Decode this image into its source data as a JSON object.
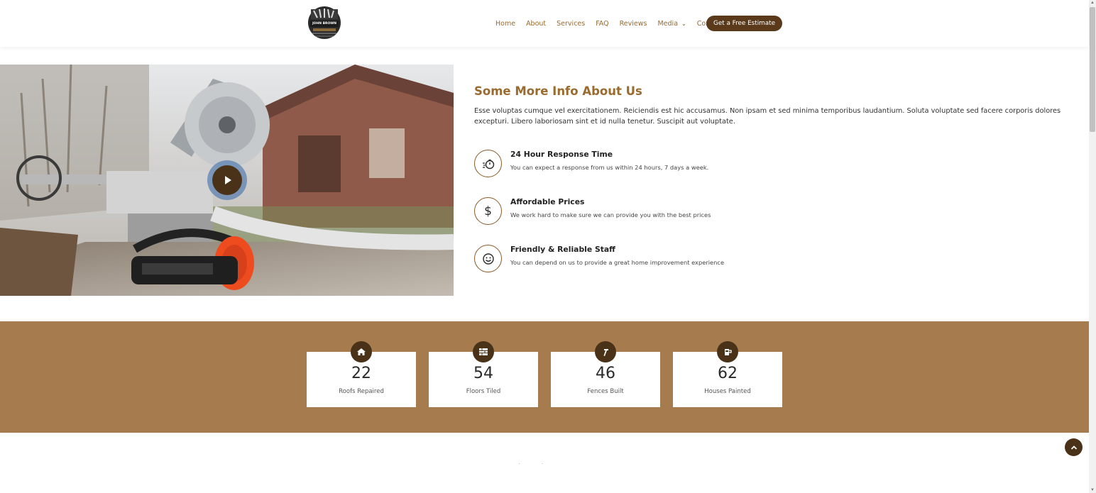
{
  "header": {
    "logo_text": "JOHN BROWN",
    "nav": [
      {
        "label": "Home"
      },
      {
        "label": "About"
      },
      {
        "label": "Services"
      },
      {
        "label": "FAQ"
      },
      {
        "label": "Reviews"
      },
      {
        "label": "Media",
        "has_dropdown": true
      },
      {
        "label": "Contact"
      }
    ],
    "cta_label": "Get a Free Estimate"
  },
  "about": {
    "title": "Some More Info About Us",
    "text": "Esse voluptas cumque vel exercitationem. Reiciendis est hic accusamus. Non ipsam et sed minima temporibus laudantium. Soluta voluptate sed facere corporis dolores excepturi. Libero laboriosam sint et id nulla tenetur. Suscipit aut voluptate.",
    "features": [
      {
        "icon": "stopwatch-icon",
        "title": "24 Hour Response Time",
        "desc": "You can expect a response from us within 24 hours, 7 days a week."
      },
      {
        "icon": "dollar-icon",
        "title": "Affordable Prices",
        "desc": "We work hard to make sure we can provide you with the best prices"
      },
      {
        "icon": "smiley-icon",
        "title": "Friendly & Reliable Staff",
        "desc": "You can depend on us to provide a great home improvement experience"
      }
    ]
  },
  "stats": [
    {
      "icon": "home-icon",
      "number": "22",
      "label": "Roofs Repaired"
    },
    {
      "icon": "tiles-icon",
      "number": "54",
      "label": "Floors Tiled"
    },
    {
      "icon": "hammer-icon",
      "number": "46",
      "label": "Fences Built"
    },
    {
      "icon": "paint-bucket-icon",
      "number": "62",
      "label": "Houses Painted"
    }
  ],
  "colors": {
    "brand_brown": "#9a6a2e",
    "dark_brown": "#4a3219",
    "stats_band": "#a67c4e"
  }
}
